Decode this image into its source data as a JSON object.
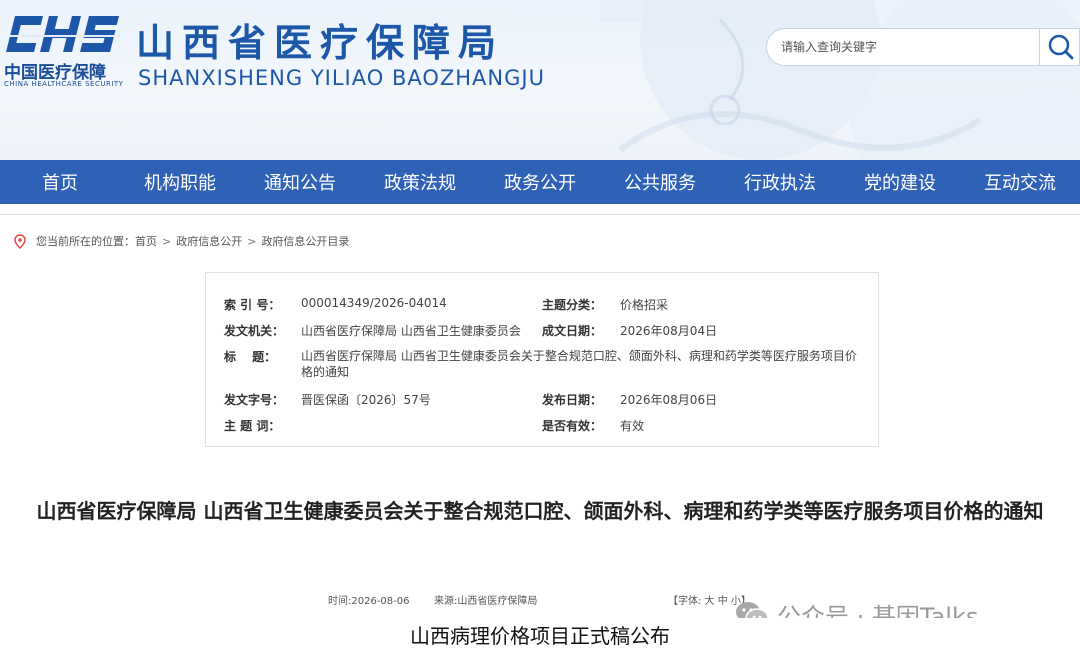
{
  "header": {
    "logo_letters": "CHS",
    "logo_cn": "中国医疗保障",
    "logo_en": "CHINA HEALTHCARE SECURITY",
    "title_cn": "山西省医疗保障局",
    "title_en": "SHANXISHENG YILIAO BAOZHANGJU",
    "search_placeholder": "请输入查询关键字"
  },
  "nav": {
    "items": [
      "首页",
      "机构职能",
      "通知公告",
      "政策法规",
      "政务公开",
      "公共服务",
      "行政执法",
      "党的建设",
      "互动交流"
    ]
  },
  "breadcrumb": {
    "prefix": "您当前所在的位置：",
    "items": [
      "首页",
      "政府信息公开",
      "政府信息公开目录"
    ],
    "separator": ">"
  },
  "info": {
    "index_label": "索 引 号：",
    "index_value": "000014349/2026-04014",
    "category_label": "主题分类：",
    "category_value": "价格招采",
    "issuer_label": "发文机关：",
    "issuer_value": "山西省医疗保障局 山西省卫生健康委员会",
    "created_label": "成文日期：",
    "created_value": "2026年08月04日",
    "title_label": "标　 题：",
    "title_value": "山西省医疗保障局 山西省卫生健康委员会关于整合规范口腔、颌面外科、病理和药学类等医疗服务项目价格的通知",
    "docno_label": "发文字号：",
    "docno_value": "晋医保函〔2026〕57号",
    "published_label": "发布日期：",
    "published_value": "2026年08月06日",
    "keywords_label": "主 题 词：",
    "keywords_value": "",
    "valid_label": "是否有效：",
    "valid_value": "有效"
  },
  "article": {
    "title": "山西省医疗保障局 山西省卫生健康委员会关于整合规范口腔、颌面外科、病理和药学类等医疗服务项目价格的通知",
    "time": "时间:2026-08-06",
    "source": "来源:山西省医疗保障局",
    "font_size_label": "【字体: 大 中 小】"
  },
  "watermark": "公众号 · 基因Talks",
  "caption": "山西病理价格项目正式稿公布",
  "colors": {
    "nav_bg": "#2f62b6",
    "brand_blue": "#1d57a8"
  }
}
